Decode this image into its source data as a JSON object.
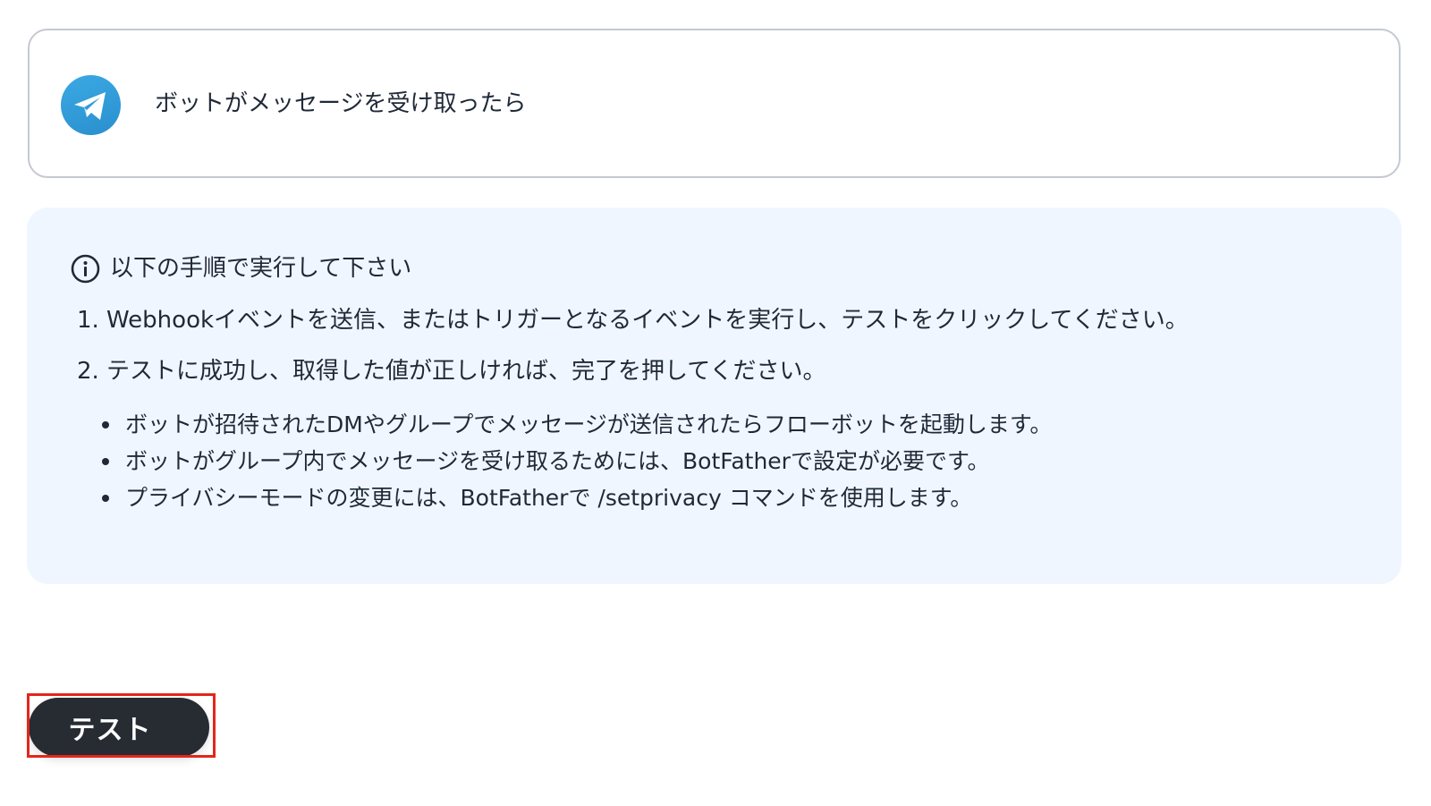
{
  "trigger": {
    "icon": "telegram-logo-icon",
    "label": "ボットがメッセージを受け取ったら"
  },
  "instructions": {
    "icon": "info-circle-icon",
    "heading": "以下の手順で実行して下さい",
    "steps": [
      {
        "num": "1.",
        "text": "Webhookイベントを送信、またはトリガーとなるイベントを実行し、テストをクリックしてください。"
      },
      {
        "num": "2.",
        "text": "テストに成功し、取得した値が正しければ、完了を押してください。"
      }
    ],
    "notes": [
      "ボットが招待されたDMやグループでメッセージが送信されたらフローボットを起動します。",
      "ボットがグループ内でメッセージを受け取るためには、BotFatherで設定が必要です。",
      "プライバシーモードの変更には、BotFatherで /setprivacy コマンドを使用します。"
    ]
  },
  "actions": {
    "test_label": "テスト"
  },
  "colors": {
    "telegram_blue": "#2f9fdc",
    "info_box_bg": "#f0f6ff",
    "button_bg": "#272b32",
    "highlight_border": "#e3261c"
  }
}
